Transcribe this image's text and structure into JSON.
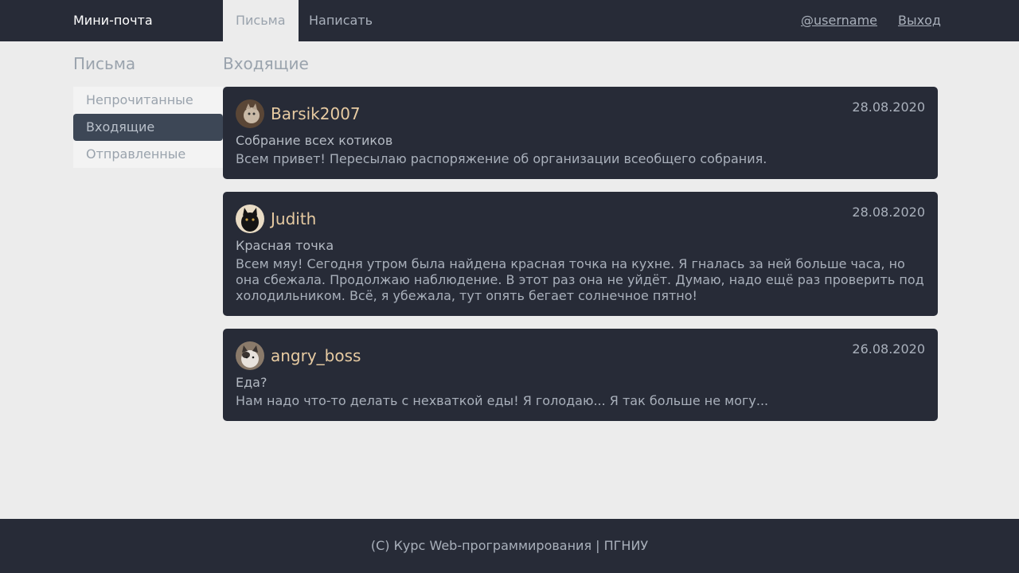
{
  "navbar": {
    "brand": "Мини-почта",
    "tabs": [
      {
        "label": "Письма",
        "active": true
      },
      {
        "label": "Написать",
        "active": false
      }
    ],
    "user": "@username",
    "logout": "Выход"
  },
  "sidebar": {
    "title": "Письма",
    "items": [
      {
        "label": "Непрочитанные",
        "active": false
      },
      {
        "label": "Входящие",
        "active": true
      },
      {
        "label": "Отправленные",
        "active": false
      }
    ]
  },
  "main": {
    "title": "Входящие",
    "messages": [
      {
        "sender": "Barsik2007",
        "date": "28.08.2020",
        "subject": "Собрание всех котиков",
        "body": "Всем привет! Пересылаю распоряжение об организации всеобщего собрания.",
        "avatar": "cat-avatar-icon"
      },
      {
        "sender": "Judith",
        "date": "28.08.2020",
        "subject": "Красная точка",
        "body": "Всем мяу! Сегодня утром была найдена красная точка на кухне. Я гналась за ней больше часа, но она сбежала. Продолжаю наблюдение. В этот раз она не уйдёт. Думаю, надо ещё раз проверить под холодильником. Всё, я убежала, тут опять бегает солнечное пятно!",
        "avatar": "cat-avatar-icon"
      },
      {
        "sender": "angry_boss",
        "date": "26.08.2020",
        "subject": "Еда?",
        "body": "Нам надо что-то делать с нехваткой еды! Я голодаю... Я так больше не могу...",
        "avatar": "cat-avatar-icon"
      }
    ]
  },
  "footer": {
    "text": "(C) Курс Web-программирования | ПГНИУ"
  },
  "colors": {
    "nav_bg": "#272b37",
    "page_bg": "#ececec",
    "sender": "#e7cba2",
    "active_side": "#3d4756"
  }
}
